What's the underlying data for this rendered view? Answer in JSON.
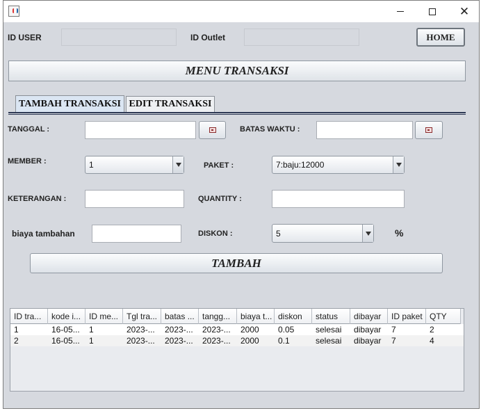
{
  "window": {
    "buttons": {
      "minimize": "minimize",
      "maximize": "maximize",
      "close": "close"
    }
  },
  "header": {
    "id_user_label": "ID USER",
    "id_user_value": "",
    "id_outlet_label": "ID Outlet",
    "id_outlet_value": "",
    "home_label": "HOME"
  },
  "menu_title": "MENU TRANSAKSI",
  "tabs": [
    {
      "label": "TAMBAH TRANSAKSI",
      "active": true
    },
    {
      "label": "EDIT TRANSAKSI",
      "active": false
    }
  ],
  "form": {
    "tanggal_label": "TANGGAL :",
    "tanggal_value": "",
    "batas_label": "BATAS WAKTU :",
    "batas_value": "",
    "member_label": "MEMBER :",
    "member_selected": "1",
    "paket_label": "PAKET :",
    "paket_selected": "7:baju:12000",
    "keterangan_label": "KETERANGAN :",
    "keterangan_value": "",
    "quantity_label": "QUANTITY :",
    "quantity_value": "",
    "biaya_label": "biaya tambahan",
    "biaya_value": "",
    "diskon_label": "DISKON :",
    "diskon_selected": "5",
    "percent": "%",
    "submit_label": "TAMBAH"
  },
  "table": {
    "columns": [
      "ID tra...",
      "kode i...",
      "ID me...",
      "Tgl tra...",
      "batas ...",
      "tangg...",
      "biaya t...",
      "diskon",
      "status",
      "dibayar",
      "ID paket",
      "QTY"
    ],
    "rows": [
      [
        "1",
        "16-05...",
        "1",
        "2023-...",
        "2023-...",
        "2023-...",
        "2000",
        "0.05",
        "selesai",
        "dibayar",
        "7",
        "2"
      ],
      [
        "2",
        "16-05...",
        "1",
        "2023-...",
        "2023-...",
        "2023-...",
        "2000",
        "0.1",
        "selesai",
        "dibayar",
        "7",
        "4"
      ]
    ]
  },
  "icons": {
    "app": "java-cup-icon",
    "calendar": "calendar-icon",
    "dropdown": "chevron-down-icon"
  },
  "colors": {
    "panel": "#d6d9df",
    "tab_active": "#dbe6f3",
    "tab_underline": "#2f3a55"
  }
}
